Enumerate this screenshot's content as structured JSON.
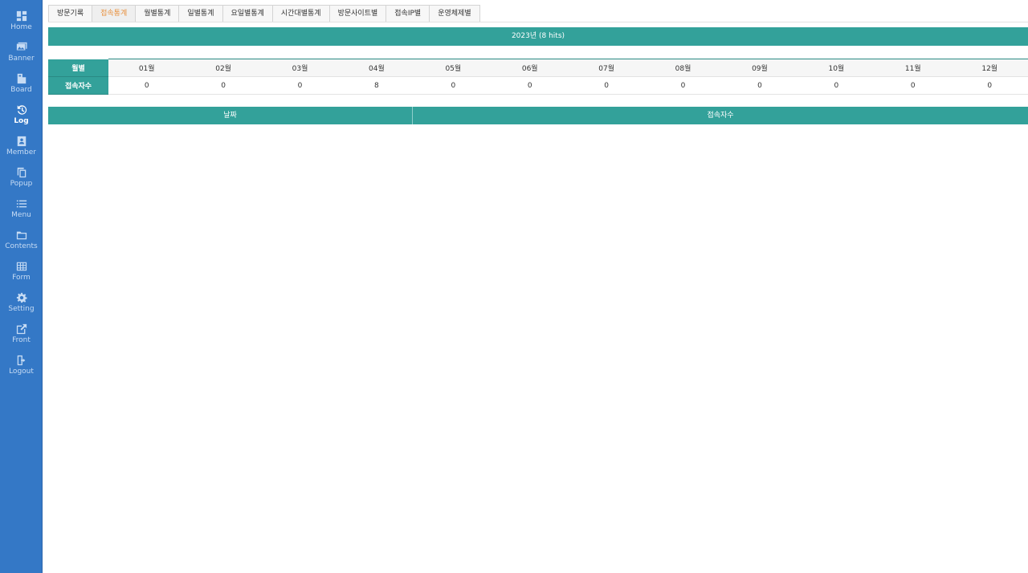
{
  "sidebar": {
    "items": [
      {
        "label": "Home",
        "icon": "dashboard-icon"
      },
      {
        "label": "Banner",
        "icon": "image-icon"
      },
      {
        "label": "Board",
        "icon": "board-icon"
      },
      {
        "label": "Log",
        "icon": "history-icon",
        "active": true
      },
      {
        "label": "Member",
        "icon": "id-card-icon"
      },
      {
        "label": "Popup",
        "icon": "copy-icon"
      },
      {
        "label": "Menu",
        "icon": "list-icon"
      },
      {
        "label": "Contents",
        "icon": "folder-icon"
      },
      {
        "label": "Form",
        "icon": "table-icon"
      },
      {
        "label": "Setting",
        "icon": "gear-icon"
      },
      {
        "label": "Front",
        "icon": "external-link-icon"
      },
      {
        "label": "Logout",
        "icon": "logout-icon"
      }
    ]
  },
  "tabs": [
    "방문기록",
    "접속통계",
    "월별통계",
    "일별통계",
    "요일별통계",
    "시간대별통계",
    "방문사이트별",
    "접속IP별",
    "운영체제별"
  ],
  "active_tab": "접속통계",
  "year_bar": "2023년 (8 hits)",
  "monthly": {
    "row_head_month": "월별",
    "row_head_count": "접속자수",
    "months": [
      "01월",
      "02월",
      "03월",
      "04월",
      "05월",
      "06월",
      "07월",
      "08월",
      "09월",
      "10월",
      "11월",
      "12월"
    ],
    "counts": [
      "0",
      "0",
      "0",
      "8",
      "0",
      "0",
      "0",
      "0",
      "0",
      "0",
      "0",
      "0"
    ]
  },
  "daily": {
    "col_date": "날짜",
    "col_count": "접속자수"
  },
  "colors": {
    "sidebar": "#3478c6",
    "teal": "#33a19a",
    "active_tab": "#e8913f"
  }
}
